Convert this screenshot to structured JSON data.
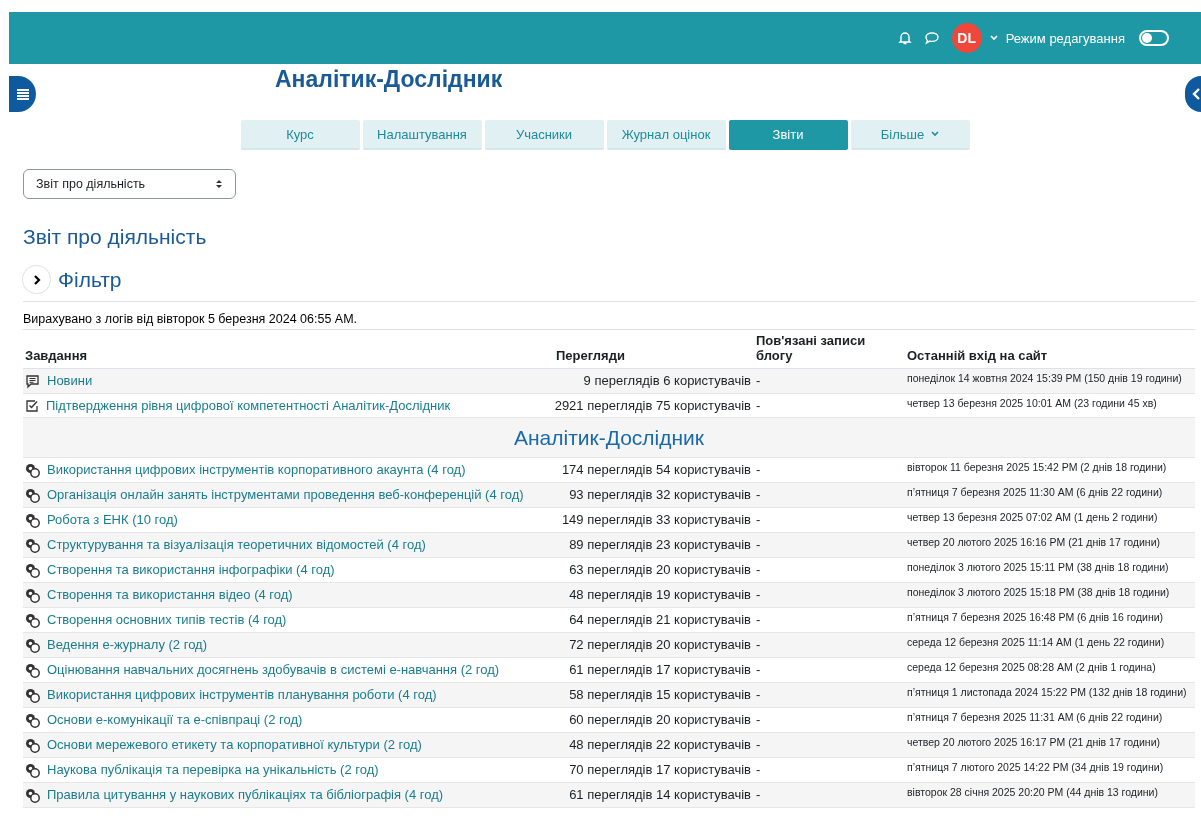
{
  "header": {
    "avatar_initials": "DL",
    "edit_mode_label": "Режим редагування",
    "edit_mode_on": false
  },
  "course_title": "Аналітик-Дослідник",
  "tabs": [
    {
      "label": "Курс",
      "selected": false,
      "kind": "link"
    },
    {
      "label": "Налаштування",
      "selected": false,
      "kind": "link"
    },
    {
      "label": "Учасники",
      "selected": false,
      "kind": "link"
    },
    {
      "label": "Журнал оцінок",
      "selected": false,
      "kind": "link"
    },
    {
      "label": "Звіти",
      "selected": true,
      "kind": "link"
    },
    {
      "label": "Більше",
      "selected": false,
      "kind": "menu"
    }
  ],
  "report_select": {
    "value": "Звіт про діяльність"
  },
  "page_heading": "Звіт про діяльність",
  "filter": {
    "label": "Фільтр",
    "expanded": false
  },
  "computed_note": "Вирахувано з логів від вівторок 5 березня 2024 06:55 AM.",
  "table": {
    "columns": [
      "Завдання",
      "Перегляди",
      "Пов'язані записи блогу",
      "Останній вхід на сайт"
    ],
    "rows": [
      {
        "kind": "forum",
        "name": "Новини",
        "views": "9 переглядів 6 користувачів",
        "blog": "-",
        "last_access": "понеділок 14 жовтня 2024 15:39 PM (150 днів 19 години)"
      },
      {
        "kind": "quiz",
        "name": "Підтвердження рівня цифрової компетентності Аналітик-Дослідник",
        "views": "2921 переглядів 75 користувачів",
        "blog": "-",
        "last_access": "четвер 13 березня 2025 10:01 AM (23 години 45 хв)"
      },
      {
        "kind": "section",
        "name": "Аналітик-Дослідник"
      },
      {
        "kind": "activity",
        "name": "Використання цифрових інструментів корпоративного акаунта (4 год)",
        "views": "174 переглядів 54 користувачів",
        "blog": "-",
        "last_access": "вівторок 11 березня 2025 15:42 PM (2 днів 18 години)"
      },
      {
        "kind": "activity",
        "name": "Організація онлайн занять інструментами проведення веб-конференцій (4 год)",
        "views": "93 переглядів 32 користувачів",
        "blog": "-",
        "last_access": "п’ятниця 7 березня 2025 11:30 AM (6 днів 22 години)"
      },
      {
        "kind": "activity",
        "name": "Робота з ЕНК (10 год)",
        "views": "149 переглядів 33 користувачів",
        "blog": "-",
        "last_access": "четвер 13 березня 2025 07:02 AM (1 день 2 години)"
      },
      {
        "kind": "activity",
        "name": "Структурування та візуалізація теоретичних відомостей (4 год)",
        "views": "89 переглядів 23 користувачів",
        "blog": "-",
        "last_access": "четвер 20 лютого 2025 16:16 PM (21 днів 17 години)"
      },
      {
        "kind": "activity",
        "name": "Створення та використання інфографіки (4 год)",
        "views": "63 переглядів 20 користувачів",
        "blog": "-",
        "last_access": "понеділок 3 лютого 2025 15:11 PM (38 днів 18 години)"
      },
      {
        "kind": "activity",
        "name": "Створення та використання відео (4 год)",
        "views": "48 переглядів 19 користувачів",
        "blog": "-",
        "last_access": "понеділок 3 лютого 2025 15:18 PM (38 днів 18 години)"
      },
      {
        "kind": "activity",
        "name": "Створення основних типів тестів (4 год)",
        "views": "64 переглядів 21 користувачів",
        "blog": "-",
        "last_access": "п’ятниця 7 березня 2025 16:48 PM (6 днів 16 години)"
      },
      {
        "kind": "activity",
        "name": "Ведення е-журналу (2 год)",
        "views": "72 переглядів 20 користувачів",
        "blog": "-",
        "last_access": "середа 12 березня 2025 11:14 AM (1 день 22 години)"
      },
      {
        "kind": "activity",
        "name": "Оцінювання навчальних досягнень здобувачів в системі е-навчання (2 год)",
        "views": "61 переглядів 17 користувачів",
        "blog": "-",
        "last_access": "середа 12 березня 2025 08:28 AM (2 днів 1 година)"
      },
      {
        "kind": "activity",
        "name": "Використання цифрових інструментів планування роботи (4 год)",
        "views": "58 переглядів 15 користувачів",
        "blog": "-",
        "last_access": "п’ятниця 1 листопада 2024 15:22 PM (132 днів 18 години)"
      },
      {
        "kind": "activity",
        "name": "Основи е-комунікації та е-співпраці (2 год)",
        "views": "60 переглядів 20 користувачів",
        "blog": "-",
        "last_access": "п’ятниця 7 березня 2025 11:31 AM (6 днів 22 години)"
      },
      {
        "kind": "activity",
        "name": "Основи мережевого етикету та корпоративної культури (2 год)",
        "views": "48 переглядів 22 користувачів",
        "blog": "-",
        "last_access": "четвер 20 лютого 2025 16:17 PM (21 днів 17 години)"
      },
      {
        "kind": "activity",
        "name": "Наукова публікація та перевірка на унікальність (2 год)",
        "views": "70 переглядів 17 користувачів",
        "blog": "-",
        "last_access": "п’ятниця 7 лютого 2025 14:22 PM (34 днів 19 години)"
      },
      {
        "kind": "activity",
        "name": "Правила цитування у наукових публікаціях та бібліографія (4 год)",
        "views": "61 переглядів 14 користувачів",
        "blog": "-",
        "last_access": "вівторок 28 січня 2025 20:20 PM (44 днів 13 години)"
      }
    ]
  }
}
